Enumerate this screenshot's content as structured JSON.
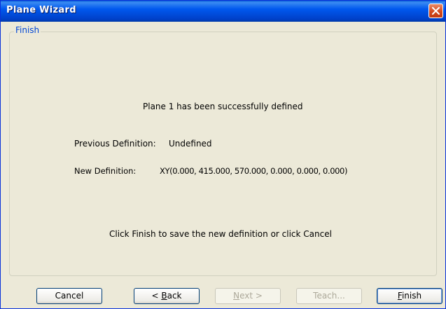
{
  "window": {
    "title": "Plane Wizard"
  },
  "group": {
    "label": "Finish"
  },
  "content": {
    "message": "Plane 1 has been successfully defined",
    "previous_label": "Previous Definition:",
    "previous_value": "Undefined",
    "new_label": "New Definition:",
    "new_value": "XY(0.000, 415.000, 570.000, 0.000, 0.000, 0.000)",
    "instruction": "Click Finish to save the new definition or click Cancel"
  },
  "buttons": {
    "cancel": "Cancel",
    "back_prefix": "< ",
    "back_accel": "B",
    "back_rest": "ack",
    "next_accel": "N",
    "next_rest": "ext >",
    "teach": "Teach...",
    "finish_accel": "F",
    "finish_rest": "inish"
  },
  "icons": {
    "close": "close-icon"
  },
  "colors": {
    "title_bar": "#0058ee",
    "group_label": "#0046d5",
    "close_button": "#d3491f"
  }
}
